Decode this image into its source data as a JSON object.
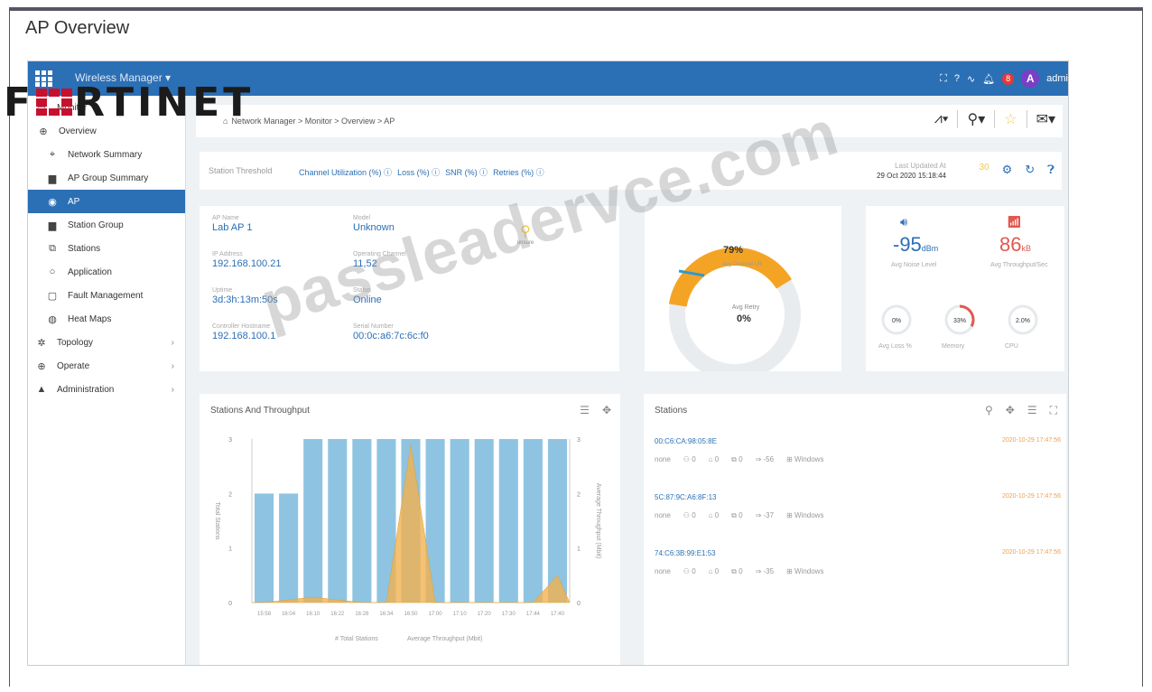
{
  "page_title": "AP Overview",
  "logo_text": "FORTINET",
  "watermark": "passleadervce.com",
  "topbar": {
    "app_name": "Wireless Manager",
    "notification_count": "8",
    "avatar_letter": "A",
    "user": "admi"
  },
  "sidebar": {
    "items": [
      {
        "label": "Monitor",
        "icon": "monitor-icon",
        "level": 0
      },
      {
        "label": "Overview",
        "icon": "plus-circle-icon",
        "level": 1
      },
      {
        "label": "Network Summary",
        "icon": "crosshair-icon",
        "level": 2
      },
      {
        "label": "AP Group Summary",
        "icon": "folder-icon",
        "level": 2
      },
      {
        "label": "AP",
        "icon": "ap-icon",
        "level": 2,
        "active": true
      },
      {
        "label": "Station Group",
        "icon": "folder-icon",
        "level": 2
      },
      {
        "label": "Stations",
        "icon": "devices-icon",
        "level": 2
      },
      {
        "label": "Application",
        "icon": "circle-icon",
        "level": 2
      },
      {
        "label": "Fault Management",
        "icon": "document-icon",
        "level": 2
      },
      {
        "label": "Heat Maps",
        "icon": "heatmap-icon",
        "level": 2
      },
      {
        "label": "Topology",
        "icon": "topology-icon",
        "level": 0,
        "chevron": true
      },
      {
        "label": "Operate",
        "icon": "plus-circle-icon",
        "level": 0,
        "chevron": true
      },
      {
        "label": "Administration",
        "icon": "user-icon",
        "level": 0,
        "chevron": true
      }
    ]
  },
  "breadcrumb": "Network Manager > Monitor > Overview > AP",
  "threshold": {
    "label": "Station Threshold",
    "items": [
      "Channel Utilization (%)",
      "Loss (%)",
      "SNR (%)",
      "Retries (%)"
    ],
    "updated_label": "Last Updated At",
    "updated_value": "29 Oct 2020 15:18:44",
    "refresh_value": "30"
  },
  "ap_info": {
    "fields": [
      {
        "key": "AP Name",
        "value": "Lab AP 1"
      },
      {
        "key": "Model",
        "value": "Unknown"
      },
      {
        "key": "IP Address",
        "value": "192.168.100.21"
      },
      {
        "key": "Operating Channel",
        "value": "11,52"
      },
      {
        "key": "Uptime",
        "value": "3d:3h:13m:50s"
      },
      {
        "key": "Status",
        "value": "Online"
      },
      {
        "key": "Controller Hostname",
        "value": "192.168.100.1"
      },
      {
        "key": "Serial Number",
        "value": "00:0c:a6:7c:6c:f0"
      }
    ],
    "location_label": "unsure"
  },
  "gauge": {
    "value_label": "79%",
    "value": 79,
    "label": "Avg Channel Util",
    "inner_value_label": "0%",
    "inner_label": "Avg Retry",
    "accent": "#f4a425",
    "track": "#e5e8eb"
  },
  "stats": {
    "noise_value": "-95",
    "noise_unit": "dBm",
    "noise_label": "Avg Noise Level",
    "throughput_value": "86",
    "throughput_unit": "kB",
    "throughput_label": "Avg Throughput/Sec",
    "minis": [
      {
        "value": "0%",
        "label": "Avg Loss %",
        "fraction": 0
      },
      {
        "value": "33%",
        "label": "Memory",
        "fraction": 0.33
      },
      {
        "value": "2.0%",
        "label": "CPU",
        "fraction": 0.02
      }
    ]
  },
  "chart": {
    "title": "Stations And Throughput",
    "legend": [
      "# Total Stations",
      "Average Throughput (Mbit)"
    ]
  },
  "chart_data": {
    "type": "bar",
    "title": "Stations And Throughput",
    "categories": [
      "15:58",
      "16:04",
      "16:10",
      "16:22",
      "16:28",
      "16:34",
      "16:50",
      "17:00",
      "17:10",
      "17:20",
      "17:30",
      "17:44",
      "17:40"
    ],
    "series": [
      {
        "name": "# Total Stations",
        "type": "bar",
        "axis": "left",
        "values": [
          2,
          2,
          3,
          3,
          3,
          3,
          3,
          3,
          3,
          3,
          3,
          3,
          3
        ]
      },
      {
        "name": "Average Throughput (Mbit)",
        "type": "area",
        "axis": "right",
        "values": [
          0,
          0.05,
          0.1,
          0.05,
          0,
          0,
          2.9,
          0,
          0,
          0,
          0,
          0,
          0.5
        ]
      }
    ],
    "ylabel": "Total Stations",
    "y2label": "Average Throughput (Mbit)",
    "ylim": [
      0,
      3
    ],
    "y2lim": [
      0,
      3
    ],
    "yticks": [
      "0",
      "1",
      "2",
      "3"
    ],
    "y2ticks": [
      "0",
      "1",
      "2",
      "3"
    ],
    "colors": {
      "bar": "#8ec4e2",
      "area": "#f3b250"
    }
  },
  "stations": {
    "title": "Stations",
    "rows": [
      {
        "mac": "00:C6:CA:98:05:8E",
        "time": "2020-10-29 17:47:56",
        "meta": [
          "none",
          "0",
          "0",
          "0",
          "-56",
          "Windows"
        ]
      },
      {
        "mac": "5C:87:9C:A6:8F:13",
        "time": "2020-10-29 17:47:56",
        "meta": [
          "none",
          "0",
          "0",
          "0",
          "-37",
          "Windows"
        ]
      },
      {
        "mac": "74:C6:3B:99:E1:53",
        "time": "2020-10-29 17:47:56",
        "meta": [
          "none",
          "0",
          "0",
          "0",
          "-35",
          "Windows"
        ]
      }
    ]
  }
}
